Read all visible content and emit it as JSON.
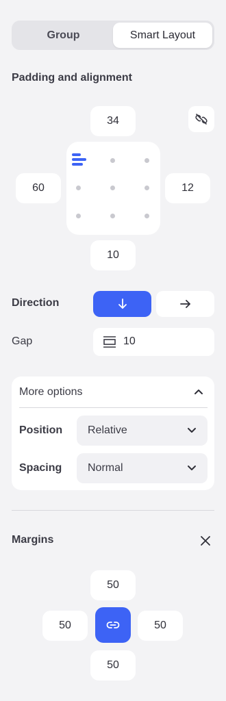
{
  "tabs": [
    {
      "label": "Group",
      "active": false
    },
    {
      "label": "Smart Layout",
      "active": true
    }
  ],
  "padding": {
    "title": "Padding and alignment",
    "top": "34",
    "left": "60",
    "right": "12",
    "bottom": "10",
    "link_icon": "unlink-icon",
    "selected_alignment": "top-left"
  },
  "direction": {
    "label": "Direction",
    "options": [
      {
        "icon": "arrow-down-icon",
        "active": true
      },
      {
        "icon": "arrow-right-icon",
        "active": false
      }
    ]
  },
  "gap": {
    "label": "Gap",
    "value": "10",
    "icon": "gap-icon"
  },
  "more_options": {
    "title": "More options",
    "expanded": true,
    "position": {
      "label": "Position",
      "value": "Relative"
    },
    "spacing": {
      "label": "Spacing",
      "value": "Normal"
    }
  },
  "margins": {
    "title": "Margins",
    "top": "50",
    "left": "50",
    "right": "50",
    "bottom": "50",
    "link_icon": "link-icon"
  },
  "colors": {
    "accent": "#3d63f5",
    "background": "#f3f3f5",
    "card": "#ffffff"
  }
}
